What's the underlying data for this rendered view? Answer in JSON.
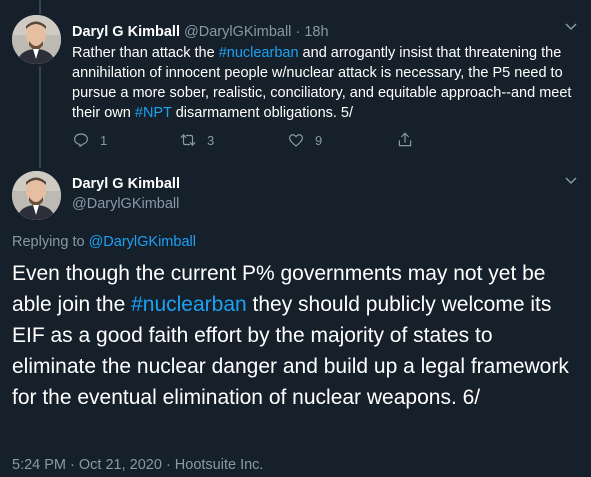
{
  "tweet1": {
    "name": "Daryl G Kimball",
    "handle": "@DarylGKimball",
    "separator": "·",
    "time": "18h",
    "text_parts": [
      {
        "text": "Rather than attack the ",
        "link": false
      },
      {
        "text": "#nuclearban",
        "link": true
      },
      {
        "text": " and arrogantly insist that threatening the annihilation of innocent people w/nuclear attack is necessary, the P5 need to pursue a more sober, realistic, conciliatory, and equitable approach--and meet their own ",
        "link": false
      },
      {
        "text": "#NPT",
        "link": true
      },
      {
        "text": " disarmament obligations. 5/",
        "link": false
      }
    ],
    "actions": {
      "reply_count": "1",
      "retweet_count": "3",
      "like_count": "9"
    }
  },
  "tweet2": {
    "name": "Daryl G Kimball",
    "handle": "@DarylGKimball",
    "replying_prefix": "Replying to ",
    "replying_to": "@DarylGKimball",
    "text_parts": [
      {
        "text": "Even though the current P% governments may not yet be able join the ",
        "link": false
      },
      {
        "text": "#nuclearban",
        "link": true
      },
      {
        "text": " they should publicly welcome its EIF as a good faith effort by the majority of states to eliminate the nuclear danger and build up a legal framework for the eventual elimination of nuclear weapons. 6/",
        "link": false
      }
    ],
    "timestamp": "5:24 PM · Oct 21, 2020 · Hootsuite Inc."
  },
  "icons": [
    "chevron-down-icon",
    "reply-icon",
    "retweet-icon",
    "like-icon",
    "share-icon"
  ],
  "colors": {
    "background": "#15202b",
    "text": "#ffffff",
    "muted": "#8899a6",
    "link": "#1da1f2",
    "divider": "#38444d"
  }
}
